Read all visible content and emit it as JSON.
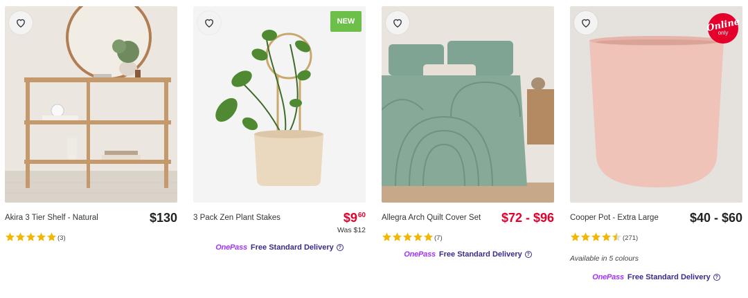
{
  "products": [
    {
      "name": "Akira 3 Tier Shelf - Natural",
      "price": "$130",
      "rating_count": "(3)",
      "stars": 5
    },
    {
      "name": "3 Pack Zen Plant Stakes",
      "price_main": "$9",
      "price_cents": "60",
      "was": "Was $12",
      "badge": "NEW",
      "delivery": {
        "brand": "OnePass",
        "text": "Free Standard Delivery"
      }
    },
    {
      "name": "Allegra Arch Quilt Cover Set",
      "price": "$72 - $96",
      "rating_count": "(7)",
      "stars": 5,
      "delivery": {
        "brand": "OnePass",
        "text": "Free Standard Delivery"
      }
    },
    {
      "name": "Cooper Pot - Extra Large",
      "price": "$40 - $60",
      "rating_count": "(271)",
      "stars": 4.5,
      "colours": "Available in 5 colours",
      "badge_line1": "Online",
      "badge_line2": "only",
      "delivery": {
        "brand": "OnePass",
        "text": "Free Standard Delivery"
      }
    }
  ],
  "colors": {
    "accent_red": "#e4002b",
    "star": "#f2b705",
    "onepass": "#a033ff",
    "delivery_text": "#3a2a88",
    "new_badge": "#6cc04a"
  },
  "icons": {
    "wishlist": "heart-icon",
    "rating": "star-icon",
    "help": "question-circle-icon"
  }
}
